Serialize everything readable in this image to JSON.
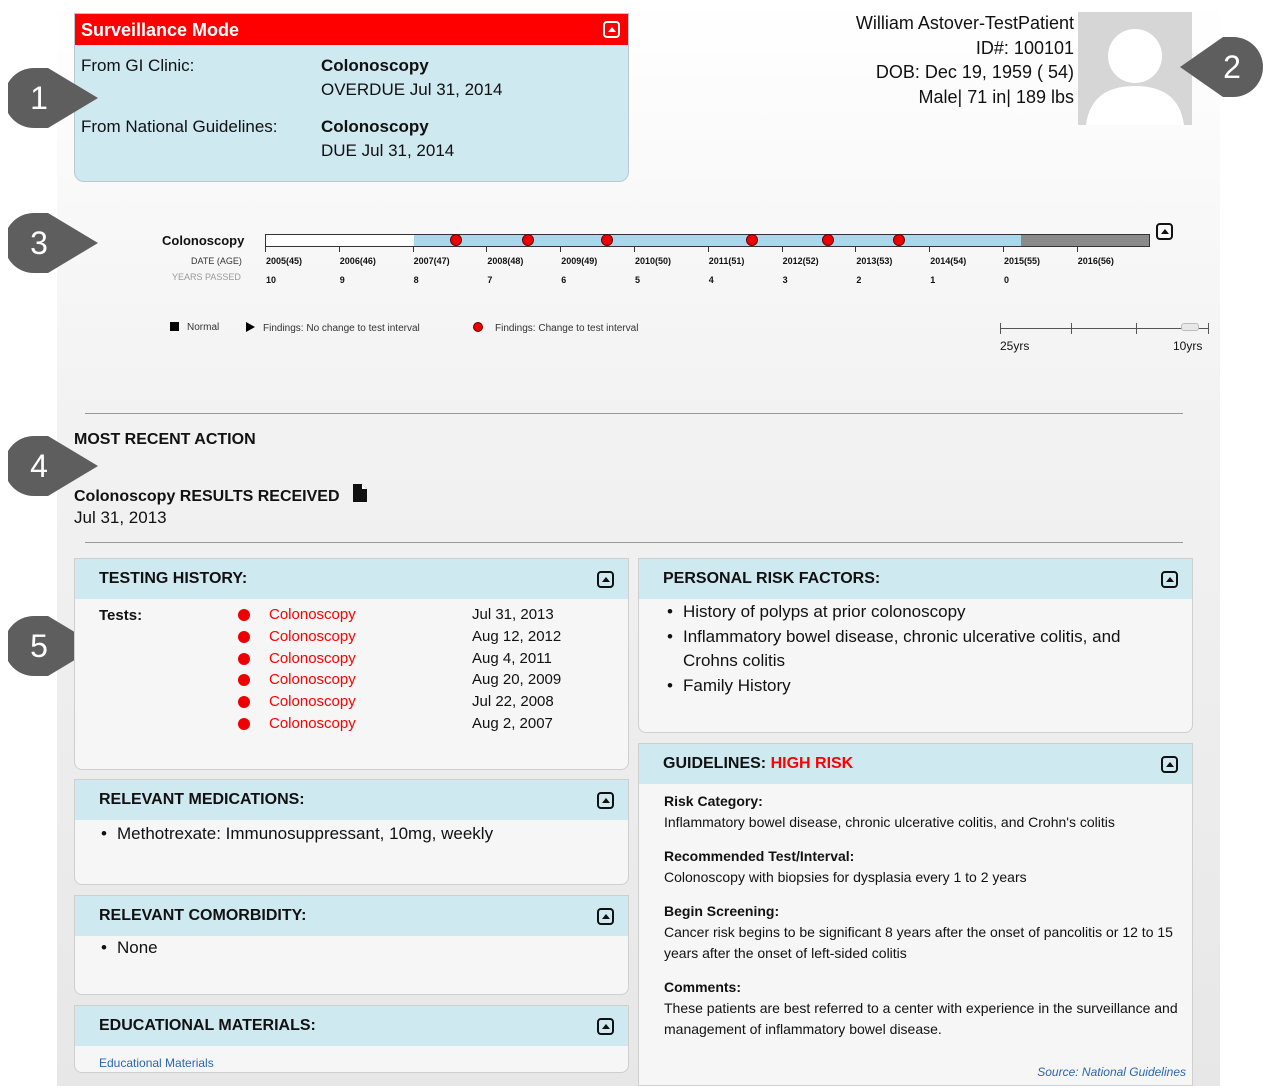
{
  "surveillance": {
    "title": "Surveillance Mode",
    "rows": [
      {
        "source": "From GI Clinic:",
        "test": "Colonoscopy",
        "status": "OVERDUE Jul 31, 2014"
      },
      {
        "source": "From National Guidelines:",
        "test": "Colonoscopy",
        "status": "DUE Jul 31, 2014"
      }
    ]
  },
  "patient": {
    "name": "William Astover-TestPatient",
    "id": "ID#: 100101",
    "dob": "DOB: Dec 19, 1959 ( 54)",
    "stats": "Male| 71 in| 189 lbs"
  },
  "callouts": [
    "1",
    "2",
    "3",
    "4",
    "5"
  ],
  "timeline": {
    "label": "Colonoscopy",
    "date_header": "DATE (AGE)",
    "years_header": "YEARS PASSED",
    "dates": [
      "2005(45)",
      "2006(46)",
      "2007(47)",
      "2008(48)",
      "2009(49)",
      "2010(50)",
      "2011(51)",
      "2012(52)",
      "2013(53)",
      "2014(54)",
      "2015(55)",
      "2016(56)"
    ],
    "years_passed": [
      "10",
      "9",
      "8",
      "7",
      "6",
      "5",
      "4",
      "3",
      "2",
      "1",
      "0"
    ],
    "legend": {
      "normal": "Normal",
      "no_change": "Findings: No change to test interval",
      "change": "Findings: Change to test interval"
    },
    "scale": {
      "left": "25yrs",
      "right": "10yrs"
    }
  },
  "recent_action": {
    "heading": "MOST RECENT ACTION",
    "title": "Colonoscopy RESULTS RECEIVED",
    "date": "Jul 31, 2013"
  },
  "testing_history": {
    "title": "TESTING HISTORY:",
    "label": "Tests:",
    "tests": [
      {
        "name": "Colonoscopy",
        "date": "Jul 31, 2013"
      },
      {
        "name": "Colonoscopy",
        "date": "Aug 12, 2012"
      },
      {
        "name": "Colonoscopy",
        "date": "Aug 4, 2011"
      },
      {
        "name": "Colonoscopy",
        "date": "Aug 20, 2009"
      },
      {
        "name": "Colonoscopy",
        "date": "Jul 22, 2008"
      },
      {
        "name": "Colonoscopy",
        "date": "Aug 2, 2007"
      }
    ]
  },
  "medications": {
    "title": "RELEVANT MEDICATIONS:",
    "items": [
      "Methotrexate: Immunosuppressant, 10mg, weekly"
    ]
  },
  "comorbidity": {
    "title": "RELEVANT COMORBIDITY:",
    "items": [
      "None"
    ]
  },
  "education": {
    "title": "EDUCATIONAL MATERIALS:",
    "link": "Educational Materials"
  },
  "risk_factors": {
    "title": "PERSONAL RISK FACTORS:",
    "items": [
      "History of polyps at prior colonoscopy",
      "Inflammatory bowel disease, chronic ulcerative colitis, and Crohns colitis",
      "Family History"
    ]
  },
  "guidelines": {
    "title": "GUIDELINES: ",
    "risk": "HIGH RISK",
    "sections": [
      {
        "heading": "Risk Category:",
        "text": "Inflammatory bowel disease, chronic ulcerative colitis, and Crohn's colitis"
      },
      {
        "heading": "Recommended Test/Interval:",
        "text": "Colonoscopy with biopsies for dysplasia every 1 to 2 years"
      },
      {
        "heading": "Begin Screening:",
        "text": "Cancer risk begins to be significant 8 years after the onset of pancolitis or 12 to 15 years after the onset of left-sided colitis"
      },
      {
        "heading": "Comments:",
        "text": "These patients are best referred to a center with experience in the surveillance and management of inflammatory bowel disease."
      }
    ],
    "source": "Source: National Guidelines"
  },
  "colors": {
    "accent_red": "#ff0000",
    "panel_blue": "#cfe9f1",
    "callout_gray": "#5e5e5e",
    "timeline_blue": "#a9d8ec",
    "timeline_gray": "#8a8a8a"
  }
}
